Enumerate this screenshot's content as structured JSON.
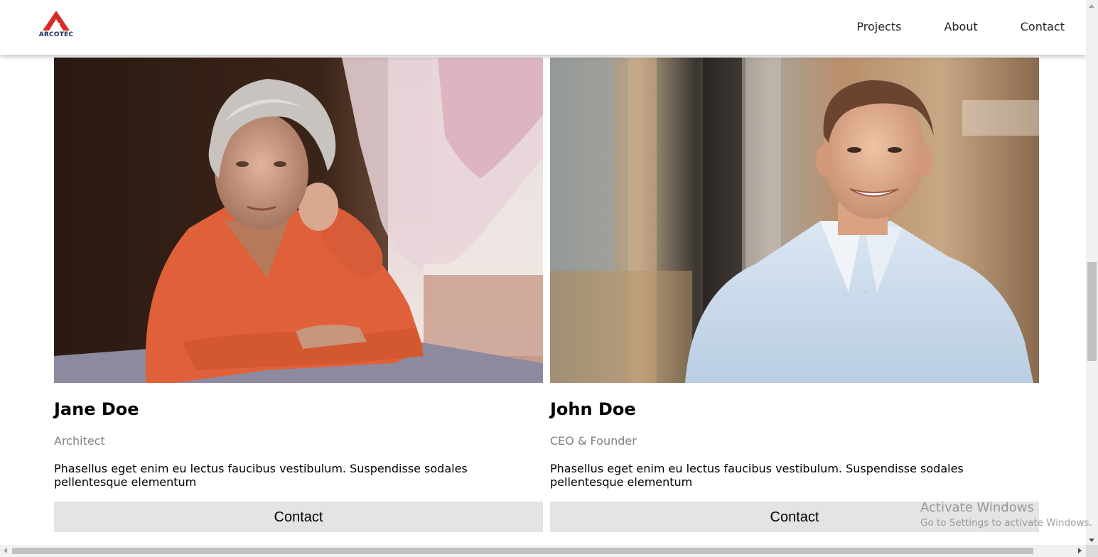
{
  "brand": {
    "logo_text": "ARCOTEC",
    "accent_color": "#d62b25",
    "text_color": "#1b2a5e"
  },
  "nav": {
    "items": [
      {
        "label": "Projects"
      },
      {
        "label": "About"
      },
      {
        "label": "Contact"
      }
    ]
  },
  "team": [
    {
      "name": "Jane Doe",
      "title": "Architect",
      "description": "Phasellus eget enim eu lectus faucibus vestibulum. Suspendisse sodales pellentesque elementum",
      "button_label": "Contact",
      "photo": "portrait-elderly-woman-orange-jacket-by-window"
    },
    {
      "name": "John Doe",
      "title": "CEO & Founder",
      "description": "Phasellus eget enim eu lectus faucibus vestibulum. Suspendisse sodales pellentesque elementum",
      "button_label": "Contact",
      "photo": "portrait-smiling-man-light-blue-shirt"
    }
  ],
  "os_watermark": {
    "title": "Activate Windows",
    "subtitle": "Go to Settings to activate Windows."
  },
  "colors": {
    "button_bg": "#e6e3e3",
    "subtitle_gray": "#808080"
  }
}
